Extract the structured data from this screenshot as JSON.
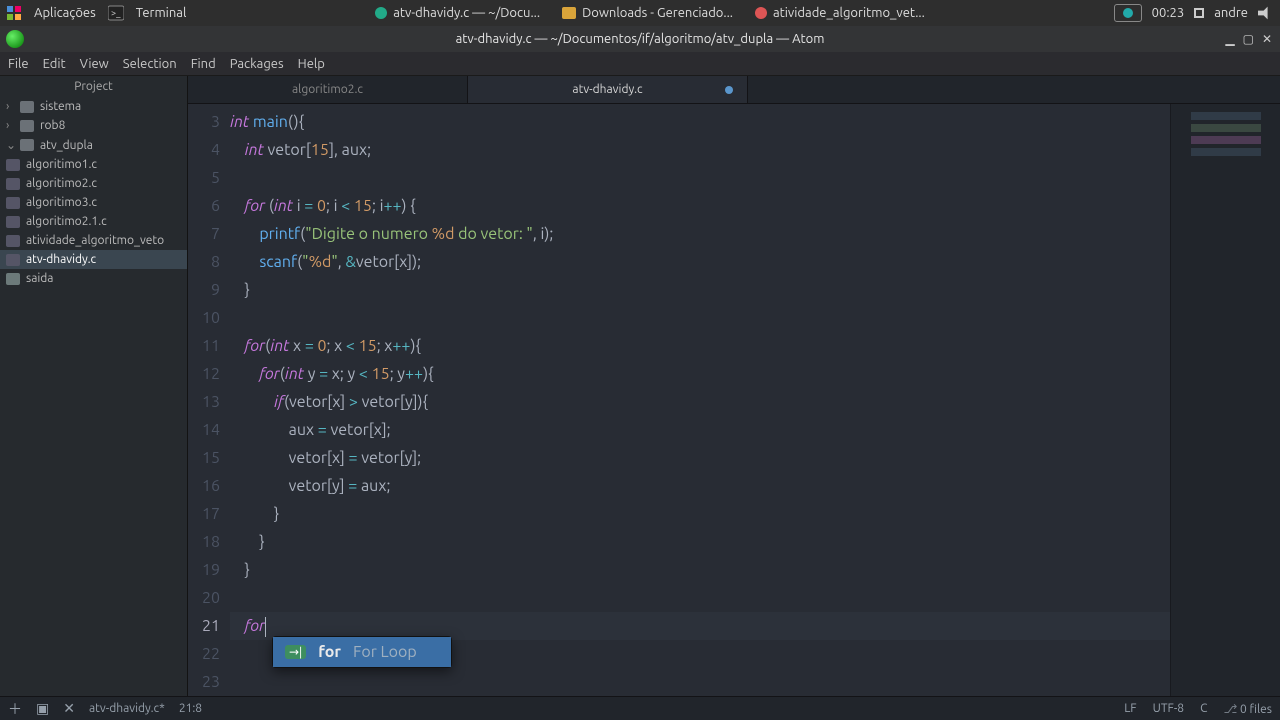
{
  "syspanel": {
    "apps_label": "Aplicações",
    "terminal_label": "Terminal",
    "task1": "atv-dhavidy.c — ~/Docu...",
    "task2": "Downloads - Gerenciado...",
    "task3": "atividade_algoritmo_vet...",
    "clock": "00:23",
    "user": "andre"
  },
  "titlebar": {
    "title": "atv-dhavidy.c — ~/Documentos/if/algoritmo/atv_dupla — Atom"
  },
  "menu": {
    "items": [
      "File",
      "Edit",
      "View",
      "Selection",
      "Find",
      "Packages",
      "Help"
    ]
  },
  "sidebar": {
    "header": "Project",
    "items": [
      {
        "label": "sistema",
        "kind": "folder",
        "chev": "›"
      },
      {
        "label": "rob8",
        "kind": "folder",
        "chev": "›"
      },
      {
        "label": "atv_dupla",
        "kind": "folder",
        "chev": "⌄",
        "open": true
      },
      {
        "label": "algoritimo1.c",
        "kind": "file"
      },
      {
        "label": "algoritimo2.c",
        "kind": "file"
      },
      {
        "label": "algoritimo3.c",
        "kind": "file"
      },
      {
        "label": "algoritimo2.1.c",
        "kind": "file"
      },
      {
        "label": "atividade_algoritmo_veto",
        "kind": "file"
      },
      {
        "label": "atv-dhavidy.c",
        "kind": "file",
        "sel": true
      },
      {
        "label": "saida",
        "kind": "file"
      }
    ]
  },
  "tabs": [
    {
      "label": "algoritimo2.c"
    },
    {
      "label": "atv-dhavidy.c",
      "active": true,
      "modified": true
    }
  ],
  "gutter_start": 3,
  "gutter_end": 23,
  "cursor_line": 21,
  "code": {
    "l3": {
      "ty": "int",
      "fn": "main",
      "rest": "(){"
    },
    "l4": {
      "ty": "int",
      "id": "vetor",
      "num": "15",
      "rest": ", aux;"
    },
    "l6": {
      "kw": "for",
      "ty": "int",
      "id": "i",
      "n0": "0",
      "n1": "15"
    },
    "l7": {
      "fn": "printf",
      "str1": "\"Digite o numero ",
      "fmt": "%d",
      "str2": " do vetor: \"",
      "id": "i"
    },
    "l8": {
      "fn": "scanf",
      "str1": "\"",
      "fmt": "%d",
      "str2": "\"",
      "amp": "&",
      "id": "vetor",
      "idx": "x"
    },
    "l11": {
      "kw": "for",
      "ty": "int",
      "id": "x",
      "n0": "0",
      "n1": "15"
    },
    "l12": {
      "kw": "for",
      "ty": "int",
      "id": "y",
      "id2": "x",
      "n1": "15"
    },
    "l13": {
      "kw": "if",
      "a": "vetor",
      "ax": "x",
      "b": "vetor",
      "bx": "y"
    },
    "l14": {
      "a": "aux",
      "b": "vetor",
      "bx": "x"
    },
    "l15": {
      "a": "vetor",
      "ax": "x",
      "b": "vetor",
      "bx": "y"
    },
    "l16": {
      "a": "vetor",
      "ax": "y",
      "b": "aux"
    },
    "l21": {
      "kw": "for"
    }
  },
  "autocomplete": {
    "kind": "→|",
    "word": "for",
    "hint": "For Loop"
  },
  "status": {
    "filename": "atv-dhavidy.c*",
    "cursor": "21:8",
    "eol": "LF",
    "encoding": "UTF-8",
    "lang": "C",
    "git": "0 files"
  }
}
